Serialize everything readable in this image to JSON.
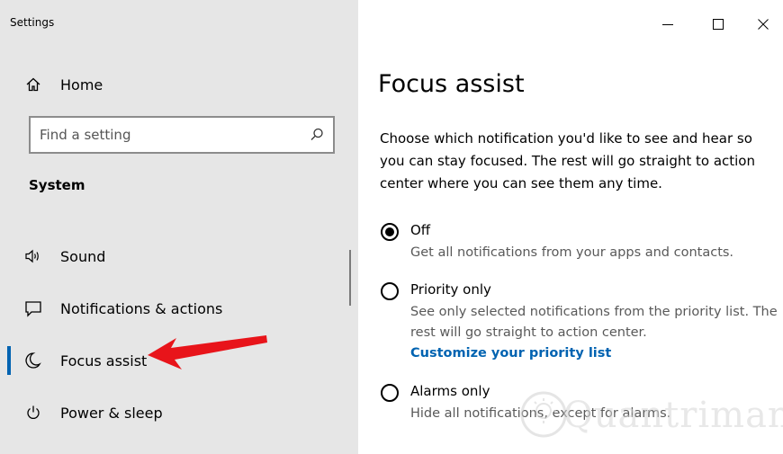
{
  "window": {
    "app_title": "Settings",
    "controls": [
      "minimize-icon",
      "maximize-icon",
      "close-icon"
    ]
  },
  "sidebar": {
    "home_label": "Home",
    "search_placeholder": "Find a setting",
    "section_title": "System",
    "items": [
      {
        "label": "Sound",
        "icon": "speaker-icon",
        "selected": false
      },
      {
        "label": "Notifications & actions",
        "icon": "notification-icon",
        "selected": false
      },
      {
        "label": "Focus assist",
        "icon": "moon-icon",
        "selected": true
      },
      {
        "label": "Power & sleep",
        "icon": "power-icon",
        "selected": false
      }
    ]
  },
  "content": {
    "title": "Focus assist",
    "description": "Choose which notification you'd like to see and hear so you can stay focused. The rest will go straight to action center where you can see them any time.",
    "options": [
      {
        "label": "Off",
        "description": "Get all notifications from your apps and contacts.",
        "checked": true
      },
      {
        "label": "Priority only",
        "description": "See only selected notifications from the priority list. The rest will go straight to action center.",
        "link": "Customize your priority list",
        "checked": false
      },
      {
        "label": "Alarms only",
        "description": "Hide all notifications, except for alarms.",
        "checked": false
      }
    ]
  },
  "watermark": {
    "text": "Quantrimang"
  },
  "colors": {
    "sidebar_bg": "#e6e6e6",
    "accent": "#0063b1",
    "arrow": "#e8141a"
  }
}
